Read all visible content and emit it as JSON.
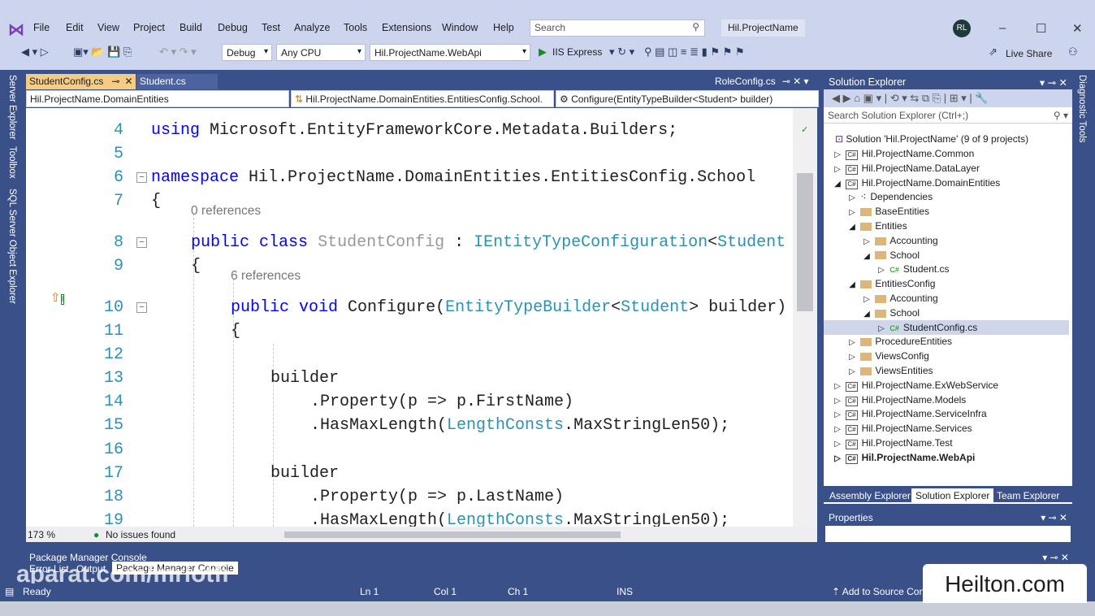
{
  "menu": [
    "File",
    "Edit",
    "View",
    "Project",
    "Build",
    "Debug",
    "Test",
    "Analyze",
    "Tools",
    "Extensions",
    "Window",
    "Help"
  ],
  "search_placeholder": "Search",
  "solution_name": "Hil.ProjectName",
  "user_initials": "RL",
  "toolbar": {
    "config": "Debug",
    "platform": "Any CPU",
    "startup": "Hil.ProjectName.WebApi",
    "run": "IIS Express",
    "live_share": "Live Share"
  },
  "side_tabs_left": [
    "Server Explorer",
    "Toolbox",
    "SQL Server Object Explorer"
  ],
  "side_tabs_right": [
    "Diagnostic Tools"
  ],
  "tabs": {
    "active": "StudentConfig.cs",
    "second": "Student.cs",
    "preview": "RoleConfig.cs"
  },
  "navbar": {
    "project": "Hil.ProjectName.DomainEntities",
    "type": "Hil.ProjectName.DomainEntities.EntitiesConfig.School.",
    "member": "Configure(EntityTypeBuilder<Student> builder)"
  },
  "code": {
    "l4": "4",
    "using": "using",
    "using_ns": " Microsoft.EntityFrameworkCore.Metadata.Builders;",
    "l5": "5",
    "l6": "6",
    "namespace": "namespace",
    "ns_name": " Hil.ProjectName.DomainEntities.EntitiesConfig.School",
    "l7": "7",
    "brace_open": "{",
    "brace_close": "}",
    "refs0": "0 references",
    "l8": "8",
    "public": "public",
    "class": "class",
    "class_name": "StudentConfig",
    "colon": " : ",
    "iface": "IEntityTypeConfiguration",
    "lt": "<",
    "student": "Student",
    "l9": "9",
    "refs6": "6 references",
    "l10": "10",
    "void": "void",
    "method": " Configure(",
    "etb": "EntityTypeBuilder",
    "gt_builder": "> builder)",
    "l11": "11",
    "l12": "12",
    "l13": "13",
    "builder": "builder",
    "l14": "14",
    "prop_first": ".Property(p => p.FirstName)",
    "l15": "15",
    "hml": ".HasMaxLength(",
    "lc": "LengthConsts",
    "msl": ".MaxStringLen50);",
    "l16": "16",
    "l17": "17",
    "l18": "18",
    "prop_last": ".Property(p => p.LastName)",
    "l19": "19"
  },
  "editor_status": {
    "zoom": "173 %",
    "issues": "No issues found"
  },
  "solution_explorer": {
    "title": "Solution Explorer",
    "search_placeholder": "Search Solution Explorer (Ctrl+;)",
    "root": "Solution 'Hil.ProjectName' (9 of 9 projects)",
    "items": [
      "Hil.ProjectName.Common",
      "Hil.ProjectName.DataLayer",
      "Hil.ProjectName.DomainEntities",
      "Dependencies",
      "BaseEntities",
      "Entities",
      "Accounting",
      "School",
      "Student.cs",
      "EntitiesConfig",
      "Accounting",
      "School",
      "StudentConfig.cs",
      "ProcedureEntities",
      "ViewsConfig",
      "ViewsEntities",
      "Hil.ProjectName.ExWebService",
      "Hil.ProjectName.Models",
      "Hil.ProjectName.ServiceInfra",
      "Hil.ProjectName.Services",
      "Hil.ProjectName.Test",
      "Hil.ProjectName.WebApi"
    ],
    "bottom_tabs": [
      "Assembly Explorer",
      "Solution Explorer",
      "Team Explorer"
    ]
  },
  "properties_title": "Properties",
  "pmc": {
    "title": "Package Manager Console",
    "tabs": [
      "Error List",
      "Output",
      "Package Manager Console"
    ]
  },
  "status": {
    "ready": "Ready",
    "ln": "Ln 1",
    "col": "Col 1",
    "ch": "Ch 1",
    "ins": "INS",
    "source": "Add to Source Control"
  },
  "watermarks": {
    "aparat": "aparat.com/mrlotfi",
    "heilton": "Heilton.com"
  }
}
